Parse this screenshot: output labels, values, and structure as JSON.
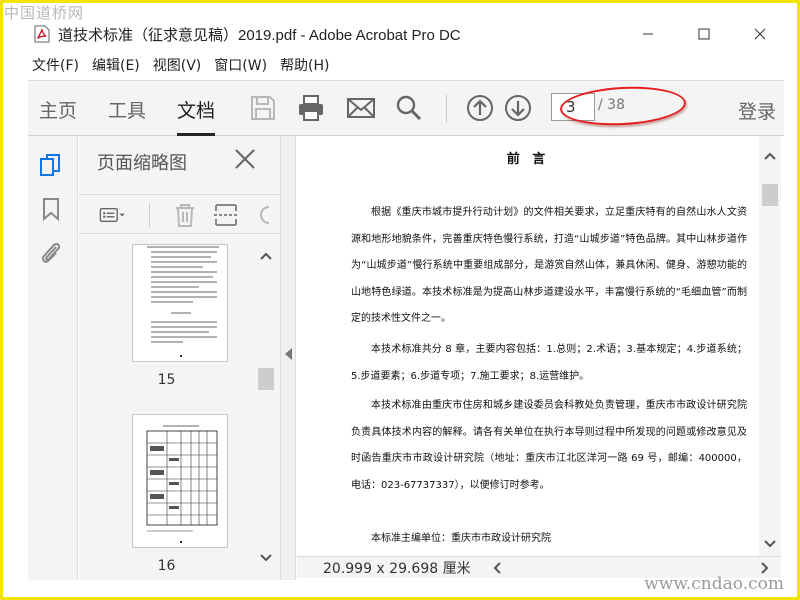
{
  "watermark": {
    "top": "中国道桥网",
    "bottom": "www.cndao.com"
  },
  "window": {
    "title": "道技术标准（征求意见稿）2019.pdf - Adobe Acrobat Pro DC",
    "controls": [
      "minimize-icon",
      "maximize-icon",
      "close-icon"
    ]
  },
  "menu": [
    "文件(F)",
    "编辑(E)",
    "视图(V)",
    "窗口(W)",
    "帮助(H)"
  ],
  "toolbar": {
    "tabs": [
      {
        "label": "主页",
        "active": false
      },
      {
        "label": "工具",
        "active": false
      },
      {
        "label": "文档",
        "active": true
      }
    ],
    "current_page": "3",
    "total_pages": "/ 38",
    "login": "登录",
    "highlight_color": "#e41e1e"
  },
  "thumbnails_panel": {
    "title": "页面缩略图",
    "pages": [
      {
        "number": "15"
      },
      {
        "number": "16"
      }
    ]
  },
  "document": {
    "heading": "前 言",
    "paragraphs": [
      "根据《重庆市城市提升行动计划》的文件相关要求，立足重庆特有的自然山水人文资源和地形地貌条件，完善重庆特色慢行系统，打造“山城步道”特色品牌。其中山林步道作为“山城步道”慢行系统中重要组成部分，是游赏自然山体，兼具休闲、健身、游憩功能的山地特色绿道。本技术标准是为提高山林步道建设水平，丰富慢行系统的“毛细血管”而制定的技术性文件之一。",
      "本技术标准共分 8 章，主要内容包括：1.总则；2.术语；3.基本规定；4.步道系统；5.步道要素；6.步道专项；7.施工要求；8.运营维护。",
      "本技术标准由重庆市住房和城乡建设委员会科教处负责管理，重庆市市政设计研究院负责具体技术内容的解释。请各有关单位在执行本导则过程中所发现的问题或修改意见及时函告重庆市市政设计研究院（地址：重庆市江北区洋河一路 69 号，邮编：400000，电话：023-67737337），以便修订时参考。",
      "本标准主编单位：重庆市市政设计研究院"
    ]
  },
  "status": {
    "page_size": "20.999 x 29.698 厘米"
  }
}
